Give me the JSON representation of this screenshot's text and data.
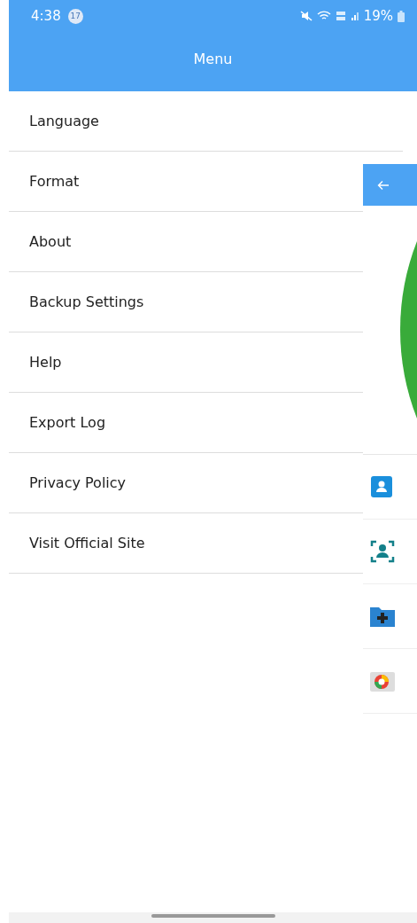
{
  "status_bar": {
    "time": "4:38",
    "notification_count": "17",
    "battery": "19%"
  },
  "header": {
    "title": "Menu"
  },
  "menu": {
    "items": [
      {
        "label": "Language"
      },
      {
        "label": "Format"
      },
      {
        "label": "About"
      },
      {
        "label": "Backup Settings"
      },
      {
        "label": "Help"
      },
      {
        "label": "Export Log"
      },
      {
        "label": "Privacy Policy"
      },
      {
        "label": "Visit Official Site"
      }
    ]
  }
}
